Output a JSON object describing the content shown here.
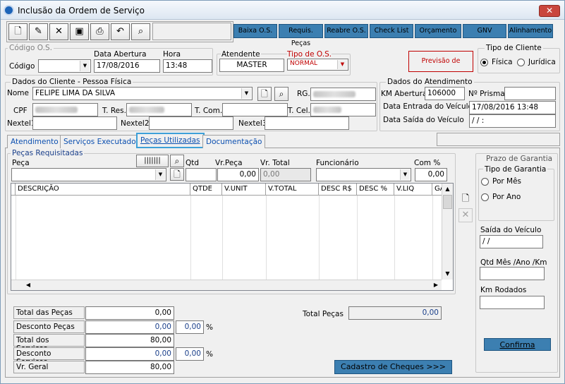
{
  "window": {
    "title": "Inclusão da Ordem de Serviço",
    "close_label": "✕"
  },
  "toolbar": {
    "icons": [
      "new-icon",
      "edit-icon",
      "delete-icon",
      "save-icon",
      "print-icon",
      "undo-icon",
      "search-icon"
    ],
    "actions": [
      "Baixa O.S.",
      "Requis. Peças",
      "Reabre O.S.",
      "Check List",
      "Orçamento",
      "GNV",
      "Alinhamento"
    ]
  },
  "os": {
    "group_title": "Código O.S.",
    "codigo_label": "Código",
    "data_abertura_label": "Data Abertura",
    "data_abertura": "17/08/2016",
    "hora_label": "Hora",
    "hora": "13:48",
    "atendente_label": "Atendente",
    "atendente": "MASTER",
    "tipo_os_label": "Tipo de O.S.",
    "tipo_os": "NORMAL",
    "previsao_button": "Previsão de Entrega"
  },
  "tipo_cliente": {
    "title": "Tipo de Cliente",
    "options": [
      "Física",
      "Jurídica"
    ],
    "selected": "Física"
  },
  "cliente": {
    "group_title": "Dados do Cliente  -  Pessoa Física",
    "nome_label": "Nome",
    "nome": "FELIPE LIMA DA SILVA",
    "rg_label": "RG.",
    "cpf_label": "CPF",
    "tres_label": "T. Res.",
    "tcom_label": "T. Com.",
    "tcel_label": "T. Cel.",
    "nextel1_label": "Nextel1",
    "nextel2_label": "Nextel2",
    "nextel3_label": "Nextel3"
  },
  "atendimento": {
    "group_title": "Dados do Atendimento",
    "km_label": "KM Abertura",
    "km": "106000",
    "prisma_label": "Nº Prisma",
    "entrada_label": "Data Entrada do Veículo",
    "entrada": "17/08/2016 13:48",
    "saida_label": "Data Saída do Veículo",
    "saida": " / /       :"
  },
  "tabs": [
    "Atendimento",
    "Serviços Executados",
    "Peças Utilizadas",
    "Documentação"
  ],
  "active_tab": "Peças Utilizadas",
  "pecas": {
    "group_title": "Peças Requisitadas",
    "peca_label": "Peça",
    "qtd_label": "Qtd",
    "vr_peca_label": "Vr.Peça",
    "vr_peca": "0,00",
    "vr_total_label": "Vr. Total",
    "vr_total": "0,00",
    "funcionario_label": "Funcionário",
    "com_label": "Com %",
    "com": "0,00",
    "columns": [
      "DESCRIÇÃO",
      "QTDE",
      "V.UNIT",
      "V.TOTAL",
      "DESC R$",
      "DESC %",
      "V.LIQ",
      "GA"
    ]
  },
  "garantia": {
    "group_title": "Prazo de Garantia",
    "tipo_title": "Tipo de Garantia",
    "options": [
      "Por Mês",
      "Por Ano"
    ],
    "saida_label": "Saída do Veículo",
    "saida": " / /",
    "qtd_label": "Qtd Mês /Ano /Km",
    "km_rodados_label": "Km Rodados",
    "confirma": "Confirma"
  },
  "totais": {
    "total_pecas_label": "Total das Peças",
    "total_pecas": "0,00",
    "desconto_pecas_label": "Desconto Peças",
    "desconto_pecas": "0,00",
    "desconto_pecas_pct": "0,00",
    "total_servicos_label": "Total dos Serviços",
    "total_servicos": "80,00",
    "desconto_servicos_label": "Desconto Serviços",
    "desconto_servicos": "0,00",
    "desconto_servicos_pct": "0,00",
    "vr_geral_label": "Vr. Geral",
    "vr_geral": "80,00",
    "pct": "%",
    "total_pecas_right_label": "Total Peças",
    "total_pecas_right": "0,00",
    "cheques_button": "Cadastro de Cheques >>>"
  }
}
